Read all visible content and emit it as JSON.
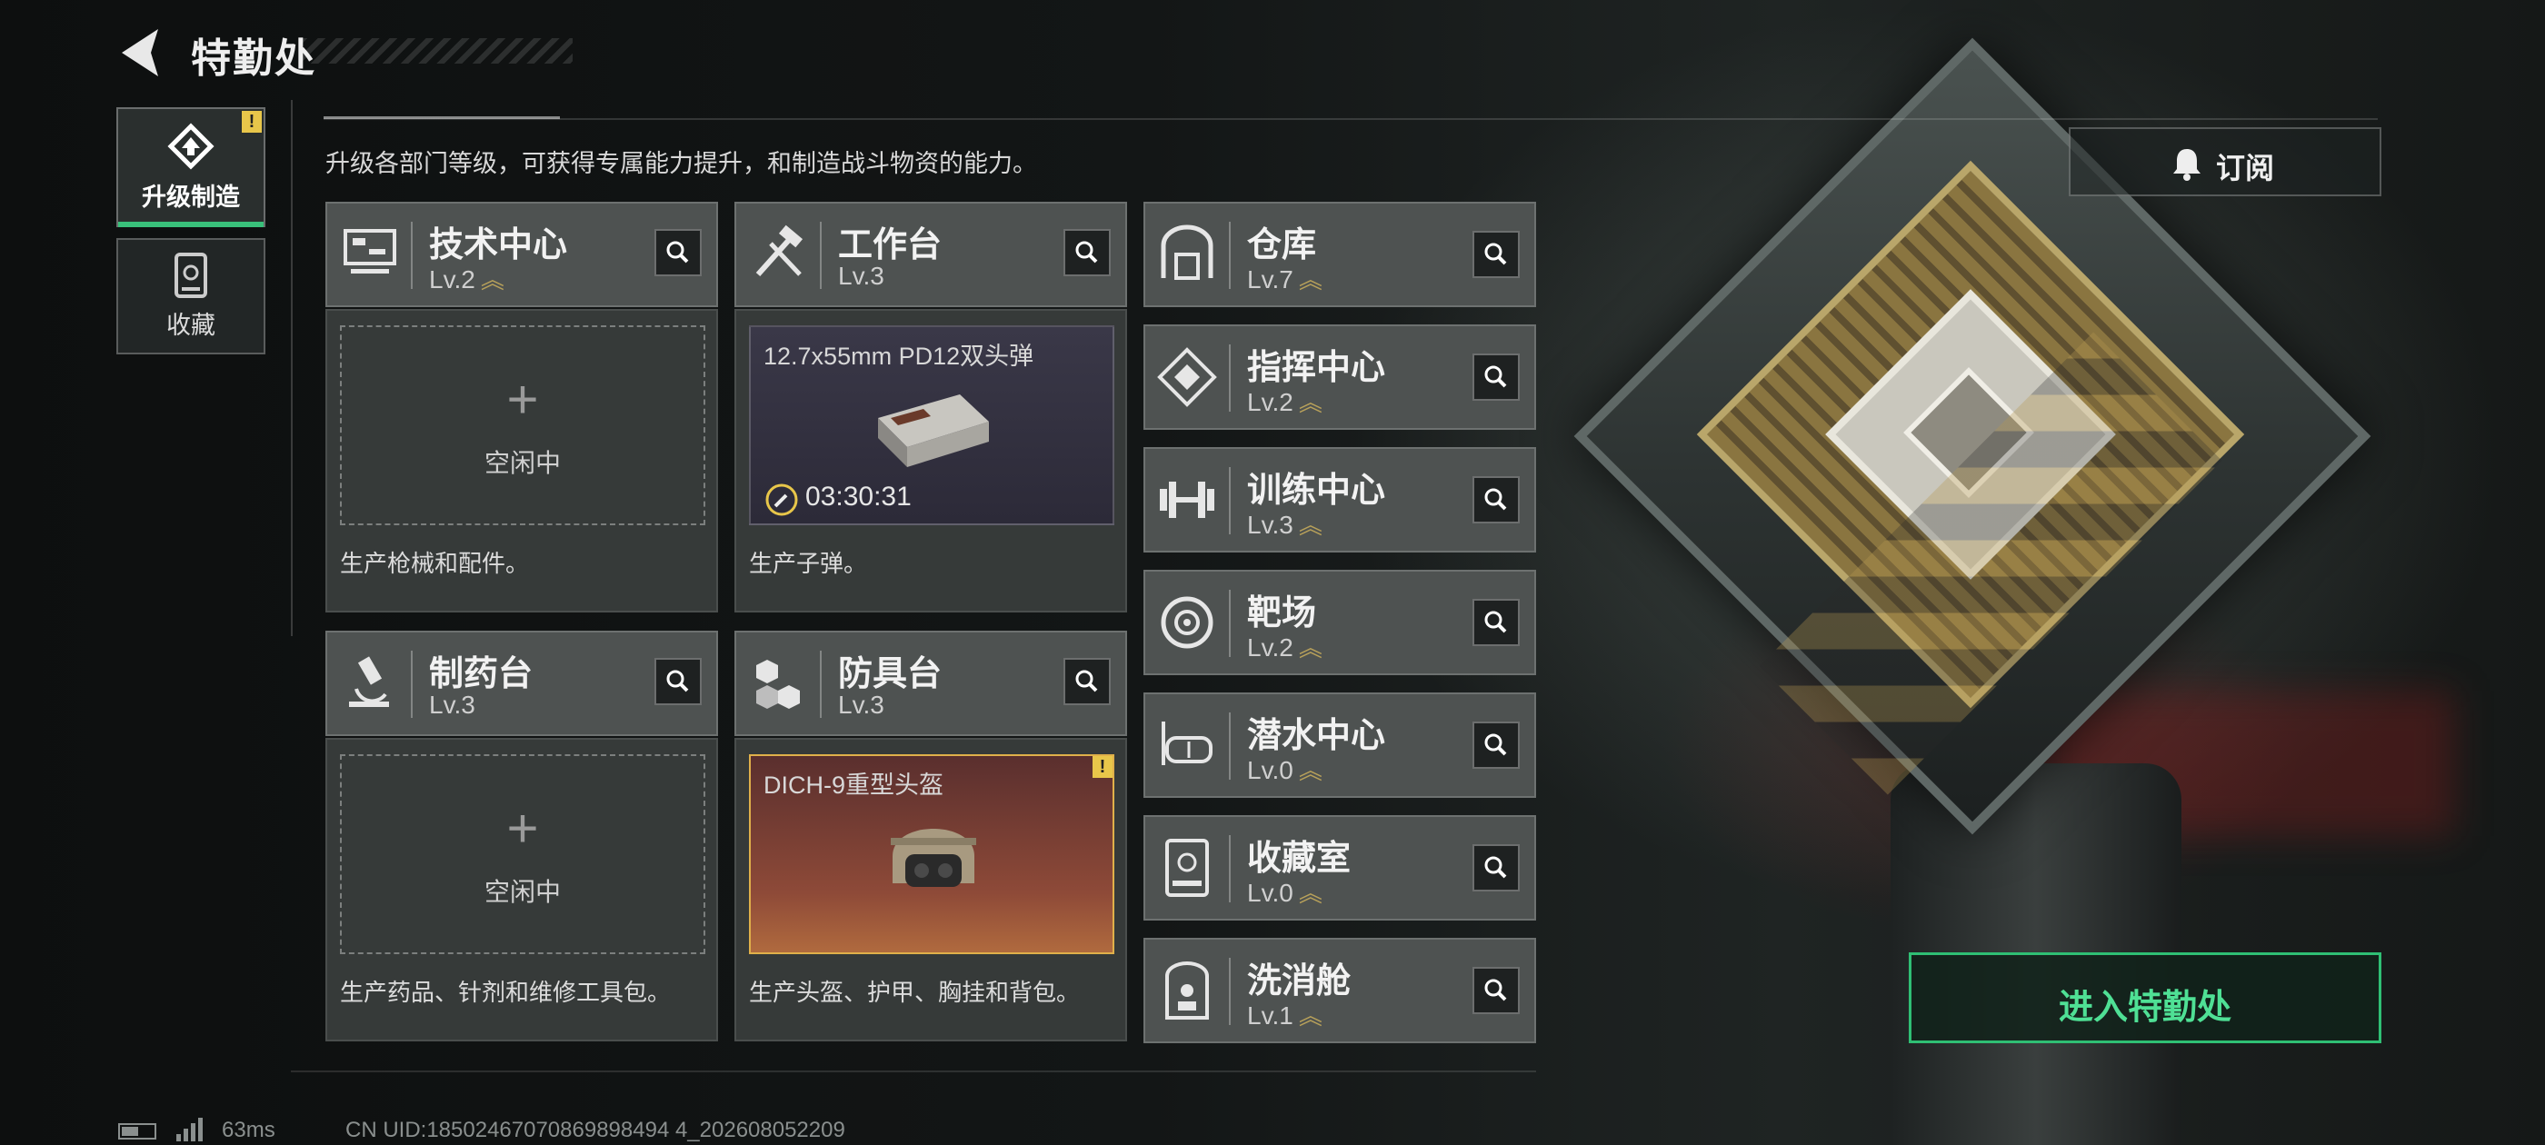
{
  "header": {
    "title": "特勤处"
  },
  "nav": {
    "tabs": [
      {
        "label": "升级制造",
        "icon": "upgrade-icon",
        "active": true,
        "badge": "!"
      },
      {
        "label": "收藏",
        "icon": "collection-icon",
        "active": false
      }
    ]
  },
  "description": "升级各部门等级，可获得专属能力提升，和制造战斗物资的能力。",
  "subscribe": {
    "label": "订阅",
    "icon": "bell-icon"
  },
  "departments": [
    {
      "name": "技术中心",
      "level": "Lv.2",
      "upgradable": true,
      "icon": "computer-icon",
      "slot": {
        "state": "空闲中"
      },
      "desc": "生产枪械和配件。"
    },
    {
      "name": "工作台",
      "level": "Lv.3",
      "upgradable": false,
      "icon": "tools-icon",
      "slot": {
        "item": "12.7x55mm PD12双头弹",
        "timer": "03:30:31"
      },
      "desc": "生产子弹。"
    },
    {
      "name": "制药台",
      "level": "Lv.3",
      "upgradable": false,
      "icon": "microscope-icon",
      "slot": {
        "state": "空闲中"
      },
      "desc": "生产药品、针剂和维修工具包。"
    },
    {
      "name": "防具台",
      "level": "Lv.3",
      "upgradable": false,
      "icon": "armor-blocks-icon",
      "slot": {
        "item": "DICH-9重型头盔",
        "badge": "!"
      },
      "desc": "生产头盔、护甲、胸挂和背包。"
    }
  ],
  "side_departments": [
    {
      "name": "仓库",
      "level": "Lv.7",
      "icon": "warehouse-icon"
    },
    {
      "name": "指挥中心",
      "level": "Lv.2",
      "icon": "command-icon"
    },
    {
      "name": "训练中心",
      "level": "Lv.3",
      "icon": "dumbbell-icon"
    },
    {
      "name": "靶场",
      "level": "Lv.2",
      "icon": "target-icon"
    },
    {
      "name": "潜水中心",
      "level": "Lv.0",
      "icon": "diving-mask-icon"
    },
    {
      "name": "收藏室",
      "level": "Lv.0",
      "icon": "display-case-icon"
    },
    {
      "name": "洗消舱",
      "level": "Lv.1",
      "icon": "decon-icon"
    }
  ],
  "upgrade_chevron": "︽",
  "plus": "+",
  "enter": {
    "label": "进入特勤处"
  },
  "status": {
    "ping": "63ms",
    "uid": "CN UID:18502467070869898494 4_202608052209"
  },
  "colors": {
    "accent_green": "#2fbf74",
    "warning_yellow": "#e8c64a",
    "chevron_gold": "#b8a15a"
  }
}
